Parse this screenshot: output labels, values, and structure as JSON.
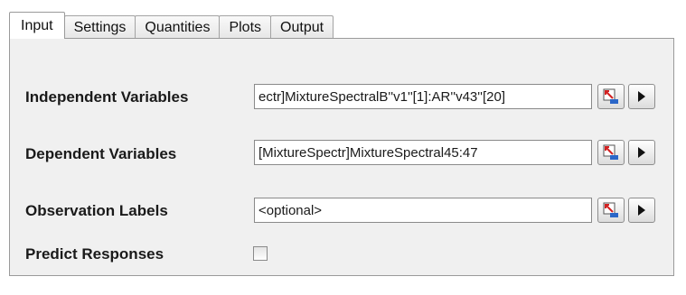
{
  "tabs": [
    {
      "label": "Input"
    },
    {
      "label": "Settings"
    },
    {
      "label": "Quantities"
    },
    {
      "label": "Plots"
    },
    {
      "label": "Output"
    }
  ],
  "active_tab": "Input",
  "fields": {
    "independent": {
      "label": "Independent Variables",
      "value": "ectr]MixtureSpectralB''v1''[1]:AR''v43''[20]"
    },
    "dependent": {
      "label": "Dependent Variables",
      "value": "[MixtureSpectr]MixtureSpectral45:47"
    },
    "observation": {
      "label": "Observation Labels",
      "value": "<optional>"
    },
    "predict": {
      "label": "Predict Responses",
      "checked": false
    }
  },
  "icons": {
    "select": "data-select-icon",
    "arrow": "play-arrow-icon"
  },
  "colors": {
    "panel_bg": "#f0f0f0",
    "icon_red": "#d22020",
    "icon_blue": "#2a66c8"
  }
}
